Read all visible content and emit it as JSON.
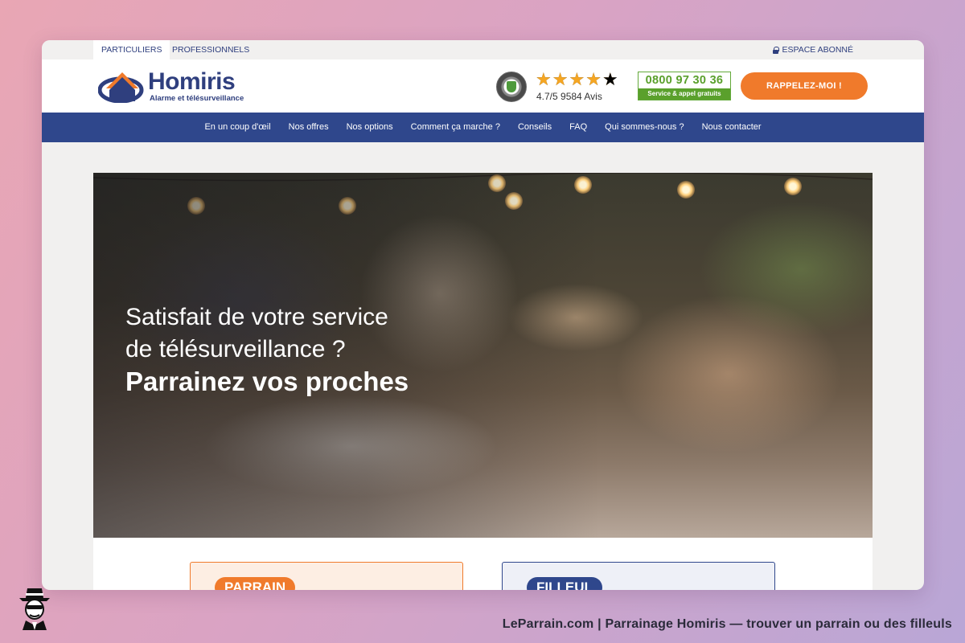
{
  "topbar": {
    "tab_particuliers": "PARTICULIERS",
    "tab_professionnels": "PROFESSIONNELS",
    "espace_abonne": "ESPACE ABONNÉ"
  },
  "header": {
    "logo_text": "Homiris",
    "logo_subtitle": "Alarme et télésurveillance",
    "rating": {
      "stars": 4.7,
      "text": "4.7/5 9584 Avis"
    },
    "phone": {
      "number": "0800 97 30 36",
      "subtitle": "Service & appel gratuits"
    },
    "callback_label": "RAPPELEZ-MOI !"
  },
  "nav": {
    "items": [
      "En un coup d'œil",
      "Nos offres",
      "Nos options",
      "Comment ça marche ?",
      "Conseils",
      "FAQ",
      "Qui sommes-nous ?",
      "Nous contacter"
    ]
  },
  "hero": {
    "line1": "Satisfait de votre service",
    "line2": "de télésurveillance ?",
    "line3": "Parrainez vos proches"
  },
  "cards": {
    "parrain": "PARRAIN",
    "filleul": "FILLEUL"
  },
  "footer": {
    "caption": "LeParrain.com | Parrainage Homiris — trouver un parrain ou des filleuls"
  },
  "colors": {
    "brand_blue": "#2f478c",
    "accent_orange": "#f07a2b",
    "phone_green": "#5aa02c",
    "star_gold": "#f5a623"
  }
}
